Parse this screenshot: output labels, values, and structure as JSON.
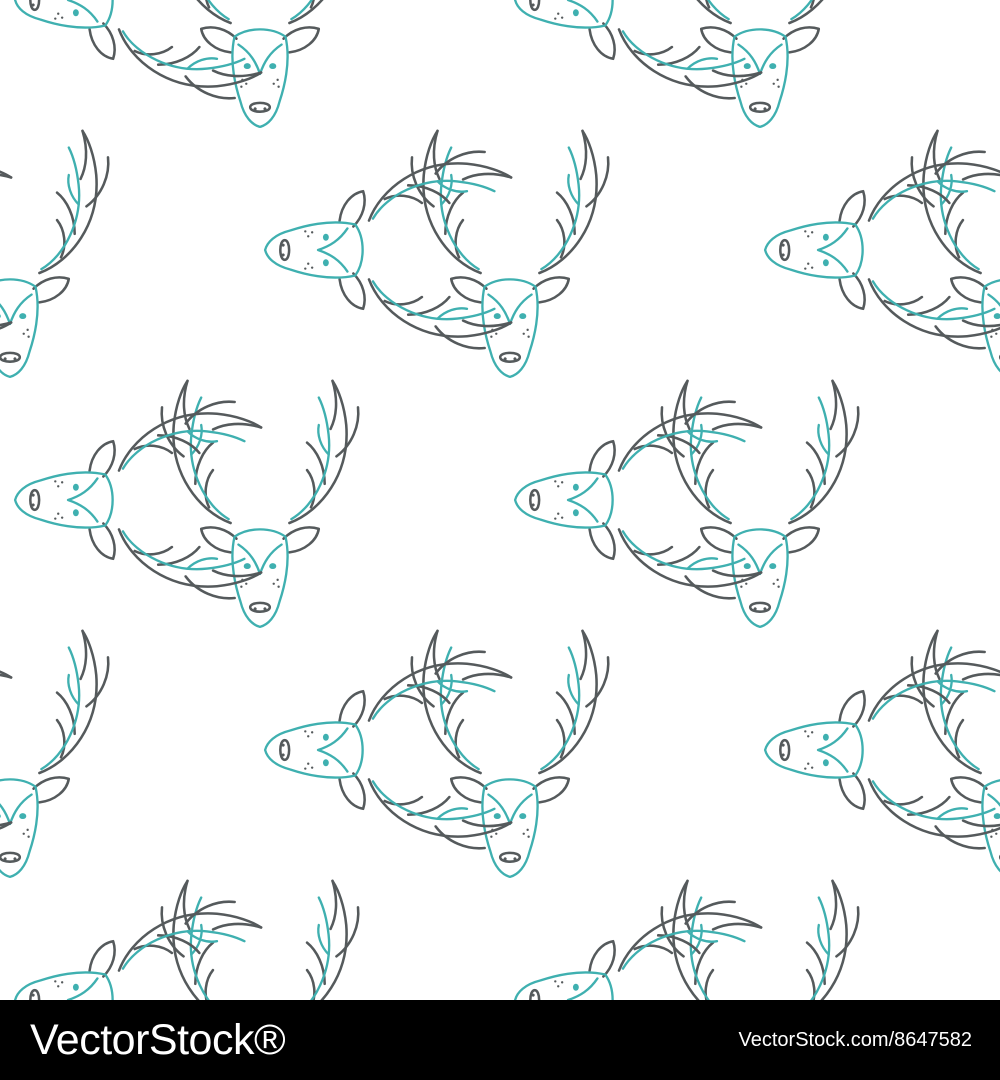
{
  "colors": {
    "background": "#ffffff",
    "antler_stroke": "#555a5c",
    "face_stroke": "#3fb0b0",
    "footer_background": "#000000",
    "footer_text": "#ffffff"
  },
  "pattern": {
    "motif_icon": "deer-head-icon",
    "orientations": [
      "upright",
      "rotated-right"
    ]
  },
  "footer": {
    "logo_text": "VectorStock®",
    "image_id": "VectorStock.com/8647582"
  }
}
